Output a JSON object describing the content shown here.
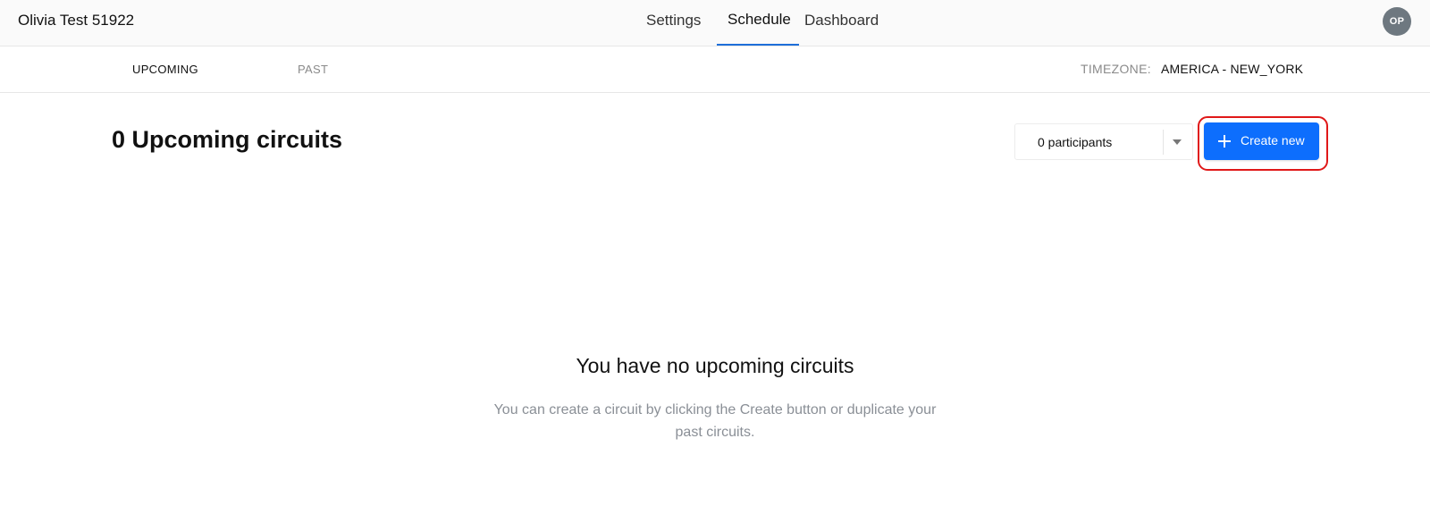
{
  "header": {
    "app_title": "Olivia Test 51922",
    "nav": {
      "settings": "Settings",
      "schedule": "Schedule",
      "dashboard": "Dashboard",
      "active": "Schedule"
    },
    "avatar_initials": "OP"
  },
  "subnav": {
    "tabs": {
      "upcoming": "UPCOMING",
      "past": "PAST",
      "active": "UPCOMING"
    },
    "timezone_label": "TIMEZONE:",
    "timezone_value": "AMERICA - NEW_YORK"
  },
  "main": {
    "heading": "0 Upcoming circuits",
    "participants_select": {
      "value": "0 participants",
      "icon": "chevron-down-icon"
    },
    "create_button": {
      "label": "Create new",
      "icon": "plus-icon"
    },
    "empty_state": {
      "title": "You have no upcoming circuits",
      "description": "You can create a circuit by clicking the Create button or duplicate your past circuits."
    }
  },
  "colors": {
    "accent": "#0d6efd",
    "highlight_outline": "#e01818",
    "nav_underline": "#1e6fd9",
    "avatar_bg": "#6e7880",
    "muted_text": "#8a8a8a"
  }
}
